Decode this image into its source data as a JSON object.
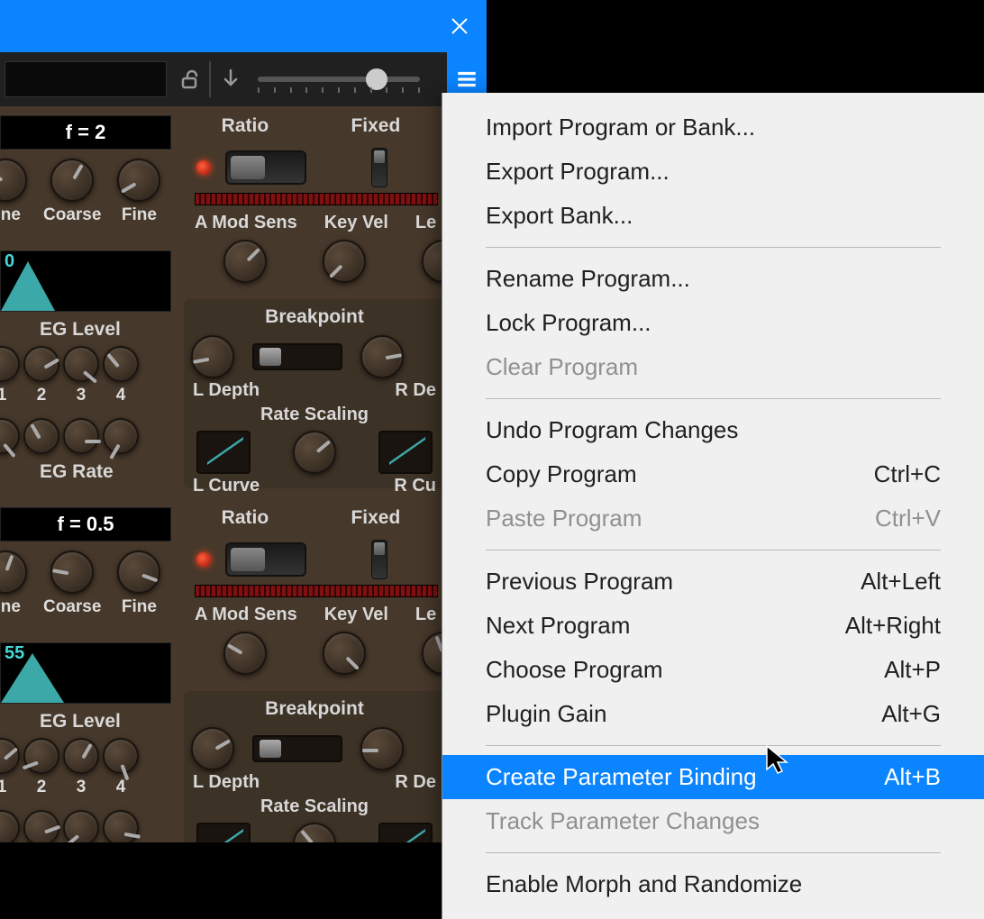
{
  "titlebar": {
    "close_icon": "close-icon"
  },
  "toolbar": {
    "lock_icon": "lock-open-icon",
    "arrow_icon": "arrow-down-icon",
    "menu_icon": "hamburger-icon"
  },
  "modules": [
    {
      "f_display": "f = 2",
      "ratio_label": "Ratio",
      "fixed_label": "Fixed",
      "tune_knobs": [
        "une",
        "Coarse",
        "Fine"
      ],
      "mod_labels": [
        "A Mod Sens",
        "Key Vel",
        "Le"
      ],
      "env_num": "0",
      "eg_level_label": "EG Level",
      "eg_nums": [
        "1",
        "2",
        "3",
        "4"
      ],
      "eg_rate_label": "EG Rate",
      "breakpoint_label": "Breakpoint",
      "ldepth_label": "L Depth",
      "rdepth_label": "R De",
      "rate_scaling_label": "Rate Scaling",
      "lcurve_label": "L Curve",
      "rcurve_label": "R Cu"
    },
    {
      "f_display": "f = 0.5",
      "ratio_label": "Ratio",
      "fixed_label": "Fixed",
      "tune_knobs": [
        "une",
        "Coarse",
        "Fine"
      ],
      "mod_labels": [
        "A Mod Sens",
        "Key Vel",
        "Le"
      ],
      "env_num": "55",
      "eg_level_label": "EG Level",
      "eg_nums": [
        "1",
        "2",
        "3",
        "4"
      ],
      "eg_rate_label": "EG Rate",
      "breakpoint_label": "Breakpoint",
      "ldepth_label": "L Depth",
      "rdepth_label": "R De",
      "rate_scaling_label": "Rate Scaling",
      "lcurve_label": "L Curve",
      "rcurve_label": "R Cu"
    }
  ],
  "menu": {
    "items": [
      {
        "label": "Import Program or Bank...",
        "shortcut": "",
        "disabled": false
      },
      {
        "label": "Export Program...",
        "shortcut": "",
        "disabled": false
      },
      {
        "label": "Export Bank...",
        "shortcut": "",
        "disabled": false
      },
      {
        "sep": true
      },
      {
        "label": "Rename Program...",
        "shortcut": "",
        "disabled": false
      },
      {
        "label": "Lock Program...",
        "shortcut": "",
        "disabled": false
      },
      {
        "label": "Clear Program",
        "shortcut": "",
        "disabled": true
      },
      {
        "sep": true
      },
      {
        "label": "Undo Program Changes",
        "shortcut": "",
        "disabled": false
      },
      {
        "label": "Copy Program",
        "shortcut": "Ctrl+C",
        "disabled": false
      },
      {
        "label": "Paste Program",
        "shortcut": "Ctrl+V",
        "disabled": true
      },
      {
        "sep": true
      },
      {
        "label": "Previous Program",
        "shortcut": "Alt+Left",
        "disabled": false
      },
      {
        "label": "Next Program",
        "shortcut": "Alt+Right",
        "disabled": false
      },
      {
        "label": "Choose Program",
        "shortcut": "Alt+P",
        "disabled": false
      },
      {
        "label": "Plugin Gain",
        "shortcut": "Alt+G",
        "disabled": false
      },
      {
        "sep": true
      },
      {
        "label": "Create Parameter Binding",
        "shortcut": "Alt+B",
        "disabled": false,
        "highlighted": true
      },
      {
        "label": "Track Parameter Changes",
        "shortcut": "",
        "disabled": true
      },
      {
        "sep": true
      },
      {
        "label": "Enable Morph and Randomize",
        "shortcut": "",
        "disabled": false
      }
    ]
  }
}
